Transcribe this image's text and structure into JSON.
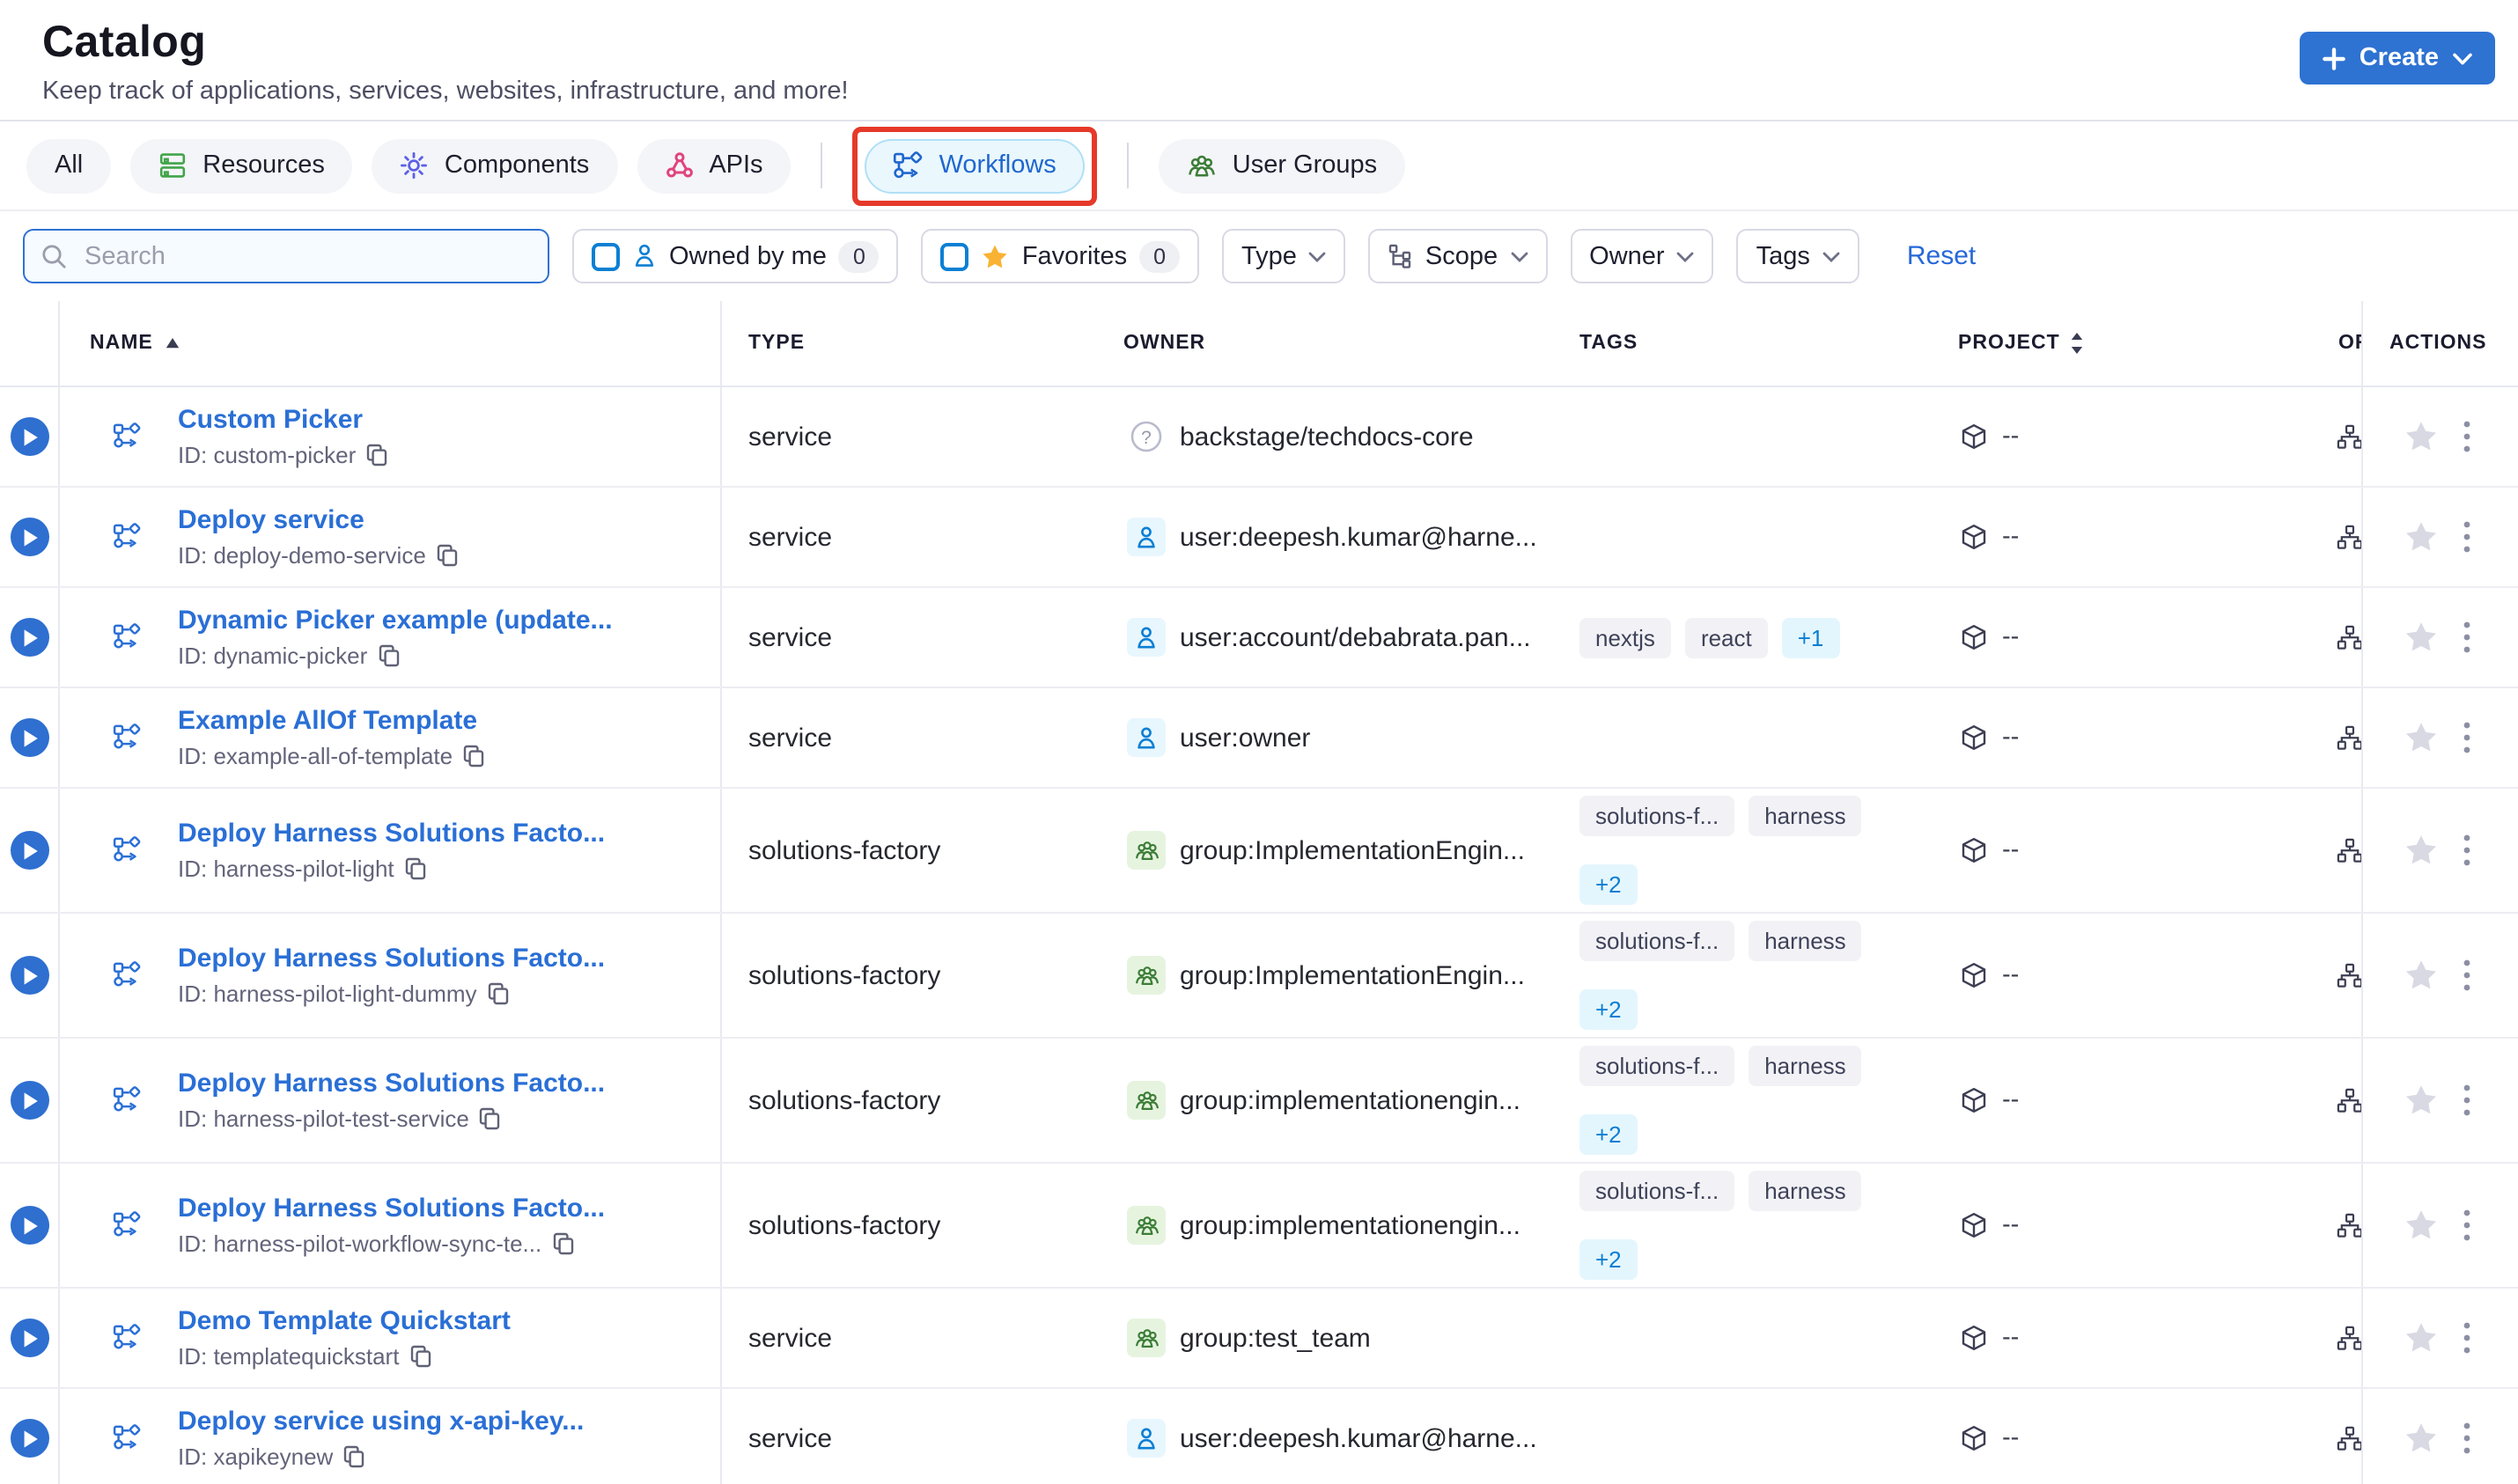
{
  "page": {
    "title": "Catalog",
    "subtitle": "Keep track of applications, services, websites, infrastructure, and more!"
  },
  "create_button": {
    "label": "Create"
  },
  "tabs": {
    "all": "All",
    "resources": "Resources",
    "components": "Components",
    "apis": "APIs",
    "workflows": "Workflows",
    "user_groups": "User Groups",
    "active_tab": "Workflows"
  },
  "filters": {
    "search_placeholder": "Search",
    "owned_by_me": {
      "label": "Owned by me",
      "count": "0"
    },
    "favorites": {
      "label": "Favorites",
      "count": "0"
    },
    "type_label": "Type",
    "scope_label": "Scope",
    "owner_label": "Owner",
    "tags_label": "Tags",
    "reset_label": "Reset"
  },
  "table": {
    "columns": {
      "name": "NAME",
      "type": "TYPE",
      "owner": "OWNER",
      "tags": "TAGS",
      "project": "PROJECT",
      "org": "ORG",
      "actions": "ACTIONS"
    },
    "sort": {
      "name": "ascending",
      "project": "sortable"
    },
    "rows": [
      {
        "name": "Custom Picker",
        "id": "ID: custom-picker",
        "type": "service",
        "owner": {
          "kind": "unknown",
          "text": "backstage/techdocs-core"
        },
        "tags": [],
        "tags_more": "",
        "project": "--",
        "tall": false
      },
      {
        "name": "Deploy service",
        "id": "ID: deploy-demo-service",
        "type": "service",
        "owner": {
          "kind": "user",
          "text": "user:deepesh.kumar@harne..."
        },
        "tags": [],
        "tags_more": "",
        "project": "--",
        "tall": false
      },
      {
        "name": "Dynamic Picker example (update...",
        "id": "ID: dynamic-picker",
        "type": "service",
        "owner": {
          "kind": "user",
          "text": "user:account/debabrata.pan..."
        },
        "tags": [
          "nextjs",
          "react"
        ],
        "tags_more": "+1",
        "project": "--",
        "tall": false
      },
      {
        "name": "Example AllOf Template",
        "id": "ID: example-all-of-template",
        "type": "service",
        "owner": {
          "kind": "user",
          "text": "user:owner"
        },
        "tags": [],
        "tags_more": "",
        "project": "--",
        "tall": false
      },
      {
        "name": "Deploy Harness Solutions Facto...",
        "id": "ID: harness-pilot-light",
        "type": "solutions-factory",
        "owner": {
          "kind": "group",
          "text": "group:ImplementationEngin..."
        },
        "tags": [
          "solutions-f...",
          "harness"
        ],
        "tags_more": "+2",
        "project": "--",
        "tall": true
      },
      {
        "name": "Deploy Harness Solutions Facto...",
        "id": "ID: harness-pilot-light-dummy",
        "type": "solutions-factory",
        "owner": {
          "kind": "group",
          "text": "group:ImplementationEngin..."
        },
        "tags": [
          "solutions-f...",
          "harness"
        ],
        "tags_more": "+2",
        "project": "--",
        "tall": true
      },
      {
        "name": "Deploy Harness Solutions Facto...",
        "id": "ID: harness-pilot-test-service",
        "type": "solutions-factory",
        "owner": {
          "kind": "group",
          "text": "group:implementationengin..."
        },
        "tags": [
          "solutions-f...",
          "harness"
        ],
        "tags_more": "+2",
        "project": "--",
        "tall": true
      },
      {
        "name": "Deploy Harness Solutions Facto...",
        "id": "ID: harness-pilot-workflow-sync-te...",
        "type": "solutions-factory",
        "owner": {
          "kind": "group",
          "text": "group:implementationengin..."
        },
        "tags": [
          "solutions-f...",
          "harness"
        ],
        "tags_more": "+2",
        "project": "--",
        "tall": true
      },
      {
        "name": "Demo Template Quickstart",
        "id": "ID: templatequickstart",
        "type": "service",
        "owner": {
          "kind": "group",
          "text": "group:test_team"
        },
        "tags": [],
        "tags_more": "",
        "project": "--",
        "tall": false
      },
      {
        "name": "Deploy service using x-api-key...",
        "id": "ID: xapikeynew",
        "type": "service",
        "owner": {
          "kind": "user",
          "text": "user:deepesh.kumar@harne..."
        },
        "tags": [],
        "tags_more": "",
        "project": "--",
        "tall": false
      }
    ]
  },
  "colors": {
    "primary_blue": "#2e72d2",
    "link_blue": "#2a6fd6",
    "active_tab_bg": "#eaf7fd",
    "active_tab_border": "#b0e0f7",
    "annotation_red": "#e5392a",
    "favorites_star_yellow": "#f9b232",
    "tag_pill_bg": "#f2f2f6",
    "more_pill_bg": "#e4f6fd",
    "more_pill_text": "#0a7ed2",
    "resources_green": "#42a44a",
    "components_violet": "#5b5fe8",
    "apis_pink": "#e0447c",
    "group_green": "#3c7d37",
    "user_blue": "#0b7fd4"
  }
}
